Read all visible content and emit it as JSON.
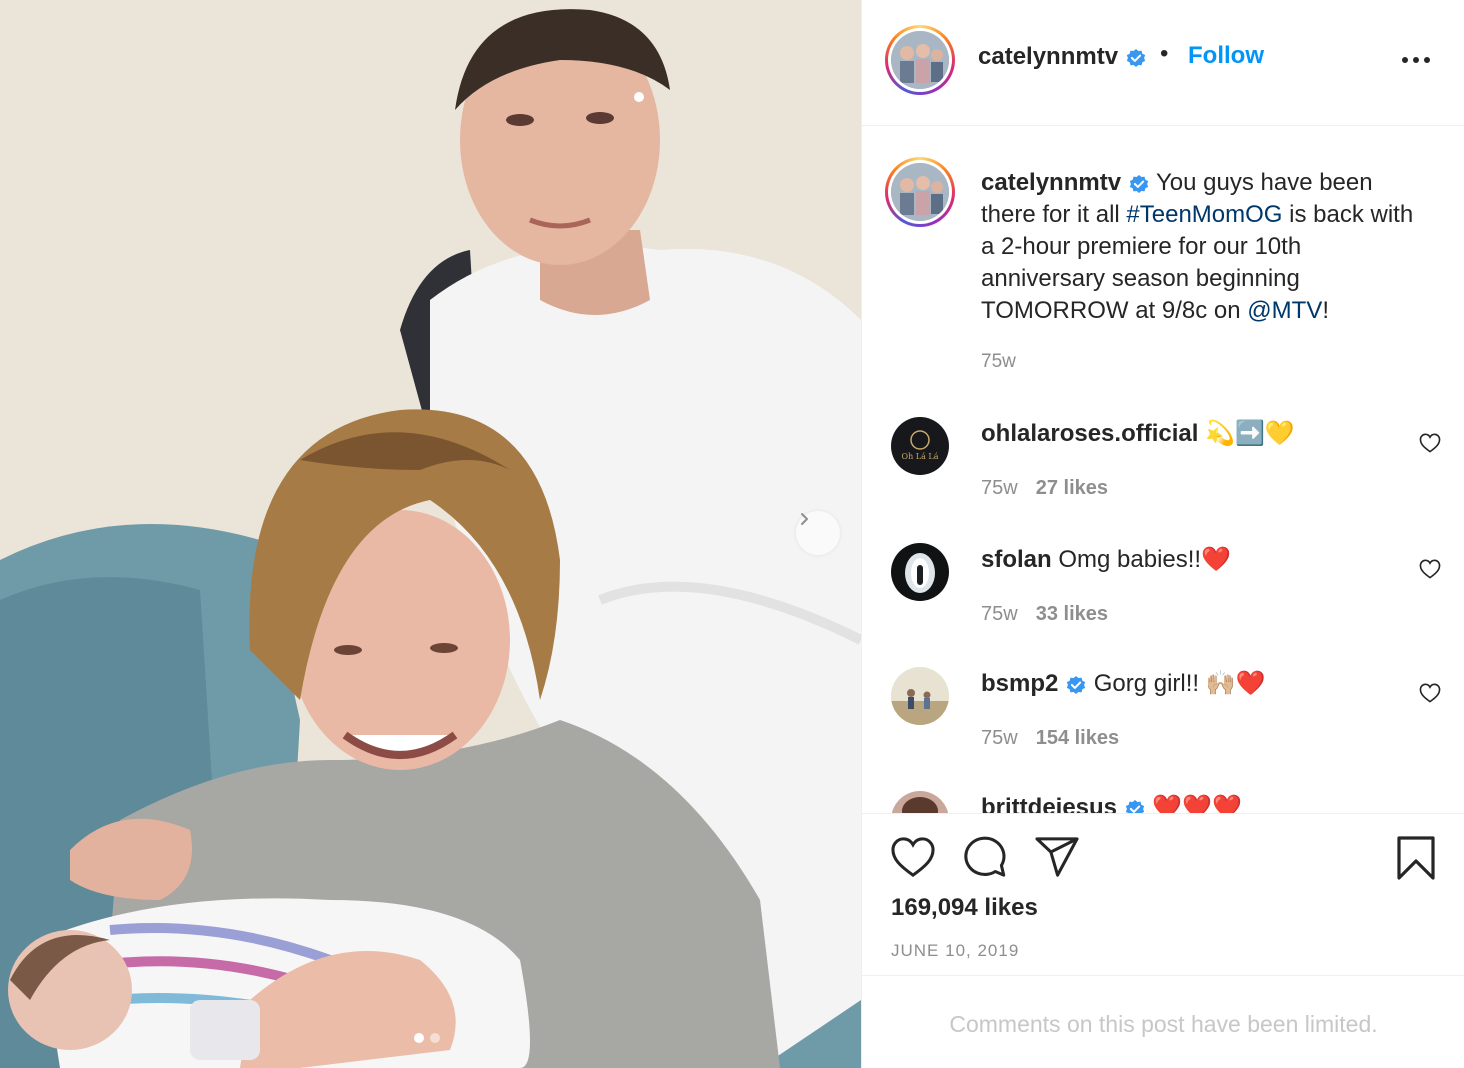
{
  "post": {
    "username": "catelynnmtv",
    "separator": "•",
    "follow_label": "Follow",
    "caption": {
      "username": "catelynnmtv",
      "text_1": "You guys have been there for it all ",
      "hashtag": "#TeenMomOG",
      "text_2": " is back with a 2-hour premiere for our 10th anniversary season beginning TOMORROW at 9/8c on ",
      "mention": "@MTV",
      "text_3": "!",
      "time": "75w"
    },
    "comments": [
      {
        "username": "ohlalaroses.official",
        "text": "💫➡️💛",
        "verified": false,
        "time": "75w",
        "likes": "27 likes"
      },
      {
        "username": "sfolan",
        "text": "Omg babies!!❤️",
        "verified": false,
        "time": "75w",
        "likes": "33 likes"
      },
      {
        "username": "bsmp2",
        "text": "Gorg girl!! 🙌🏼❤️",
        "verified": true,
        "time": "75w",
        "likes": "154 likes"
      },
      {
        "username": "brittdejesus",
        "text": "❤️❤️❤️",
        "verified": true,
        "time": "",
        "likes": ""
      }
    ],
    "likes_total": "169,094 likes",
    "date": "JUNE 10, 2019",
    "comments_limited": "Comments on this post have been limited.",
    "carousel": {
      "slides": 2,
      "active": 1
    }
  },
  "colors": {
    "accent": "#0095f6",
    "link": "#00376b",
    "verified": "#3897f0",
    "muted": "#8e8e8e"
  },
  "icons": [
    "verified-badge-icon",
    "more-options-icon",
    "heart-icon",
    "comment-icon",
    "share-icon",
    "bookmark-icon",
    "chevron-right-icon"
  ]
}
